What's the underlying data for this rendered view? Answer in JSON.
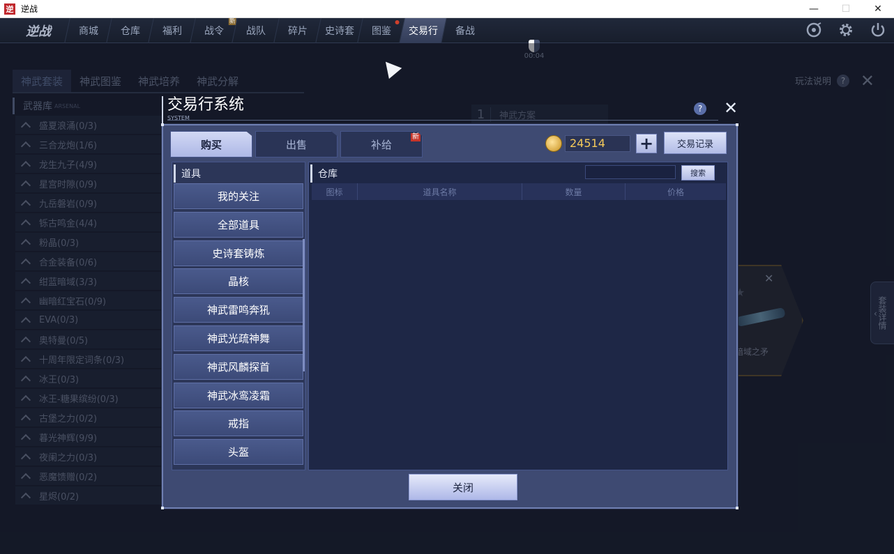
{
  "window": {
    "title": "逆战",
    "logo_text": "逆",
    "minimize": "—",
    "maximize": "☐",
    "close": "✕"
  },
  "game": {
    "logo": "逆战",
    "nav_tabs": [
      {
        "label": "商城"
      },
      {
        "label": "仓库"
      },
      {
        "label": "福利"
      },
      {
        "label": "战令",
        "badge": "新"
      },
      {
        "label": "战队"
      },
      {
        "label": "碎片"
      },
      {
        "label": "史诗套"
      },
      {
        "label": "图鉴",
        "dot": true
      },
      {
        "label": "交易行",
        "active": true
      },
      {
        "label": "备战"
      }
    ],
    "timer": "00:04",
    "icons": [
      "settings-ring-icon",
      "gear-icon",
      "power-icon"
    ]
  },
  "background_page": {
    "subtabs": [
      "神武套装",
      "神武图鉴",
      "神武培养",
      "神武分解"
    ],
    "help_label": "玩法说明",
    "help_icon": "?",
    "close_icon": "✕",
    "arsenal_title": "武器库",
    "arsenal_sub": "ARSENAL",
    "weapon_items": [
      "盛夏浪涌(0/3)",
      "三合龙炮(1/6)",
      "龙生九子(4/9)",
      "星宫时隙(0/9)",
      "九岳磐岩(0/9)",
      "铄古鸣金(4/4)",
      "粉晶(0/3)",
      "合金装备(0/6)",
      "绀蓝暗域(3/3)",
      "幽暗红宝石(0/9)",
      "EVA(0/3)",
      "奥特曼(0/5)",
      "十周年限定词条(0/3)",
      "冰王(0/3)",
      "冰王-糖果缤纷(0/3)",
      "古堡之力(0/2)",
      "暮光神辉(9/9)",
      "夜阑之力(0/3)",
      "恶魔馈赠(0/2)",
      "星烬(0/2)"
    ],
    "plan": {
      "number": "1",
      "label": "神武方案"
    },
    "card": {
      "name": "暗域之矛",
      "close": "✕",
      "star": "★"
    },
    "side_detail": "套装详情",
    "side_arrow": "‹"
  },
  "dialog": {
    "title": "交易行系统",
    "subtitle": "SYSTEM",
    "help_icon": "?",
    "close_icon": "✕",
    "tabs": [
      {
        "label": "购买",
        "active": true
      },
      {
        "label": "出售"
      },
      {
        "label": "补给",
        "badge": "新"
      }
    ],
    "coins": "24514",
    "plus": "+",
    "record_button": "交易记录",
    "category_header": "道具",
    "categories": [
      "我的关注",
      "全部道具",
      "史诗套铸炼",
      "晶核",
      "神武雷鸣奔犼",
      "神武光疏神舞",
      "神武风麟探首",
      "神武冰鸾凌霜",
      "戒指",
      "头盔"
    ],
    "warehouse_header": "仓库",
    "search_placeholder": "",
    "search_button": "搜索",
    "columns": [
      "图标",
      "道具名称",
      "数量",
      "价格"
    ],
    "close_button": "关闭"
  }
}
